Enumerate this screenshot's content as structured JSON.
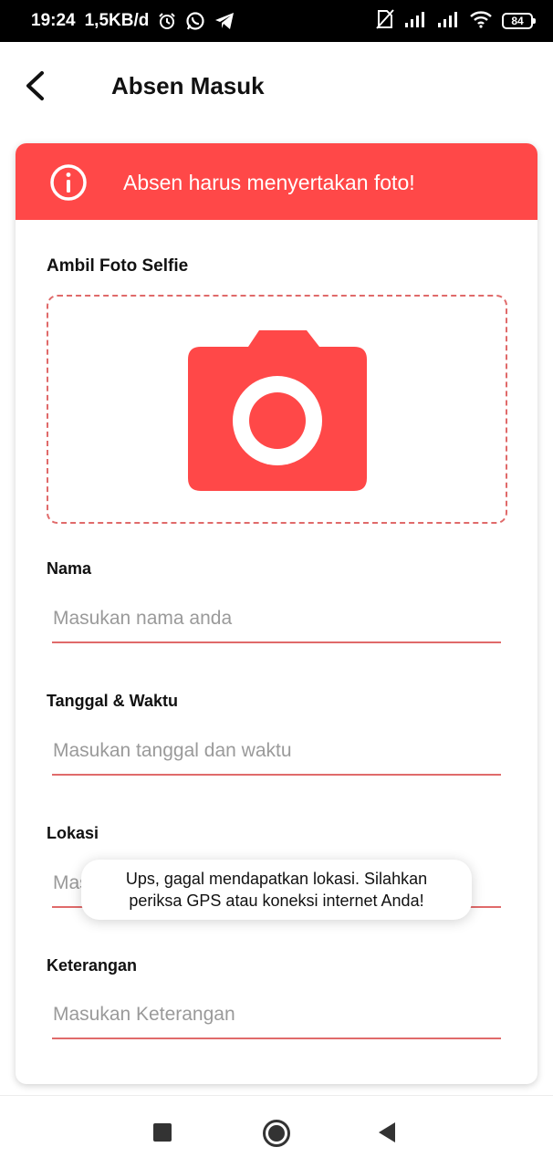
{
  "status_bar": {
    "time": "19:24",
    "speed": "1,5KB/d",
    "battery": "84",
    "icons": [
      "alarm-icon",
      "whatsapp-icon",
      "telegram-icon",
      "no-sim-icon",
      "signal-icon",
      "signal-icon",
      "wifi-icon",
      "battery-icon"
    ]
  },
  "app_bar": {
    "title": "Absen Masuk",
    "back_icon": "chevron-left-icon"
  },
  "alert": {
    "icon": "info-icon",
    "message": "Absen harus menyertakan foto!",
    "background": "#ff4848"
  },
  "photo": {
    "label": "Ambil Foto Selfie",
    "icon": "camera-icon"
  },
  "form": {
    "nama": {
      "label": "Nama",
      "placeholder": "Masukan nama anda",
      "value": ""
    },
    "tanggal": {
      "label": "Tanggal & Waktu",
      "placeholder": "Masukan tanggal dan waktu",
      "value": ""
    },
    "lokasi": {
      "label": "Lokasi",
      "placeholder": "Masukan lokasi",
      "value": ""
    },
    "keterangan": {
      "label": "Keterangan",
      "placeholder": "Masukan Keterangan",
      "value": ""
    }
  },
  "toast": {
    "line1": "Ups, gagal mendapatkan lokasi. Silahkan",
    "line2": "periksa GPS atau koneksi internet Anda!"
  },
  "nav_bar": {
    "items": [
      "recents-icon",
      "home-icon",
      "back-icon"
    ]
  },
  "colors": {
    "accent": "#ff4848",
    "underline": "#e06a6a",
    "placeholder": "#9a9a9a"
  }
}
